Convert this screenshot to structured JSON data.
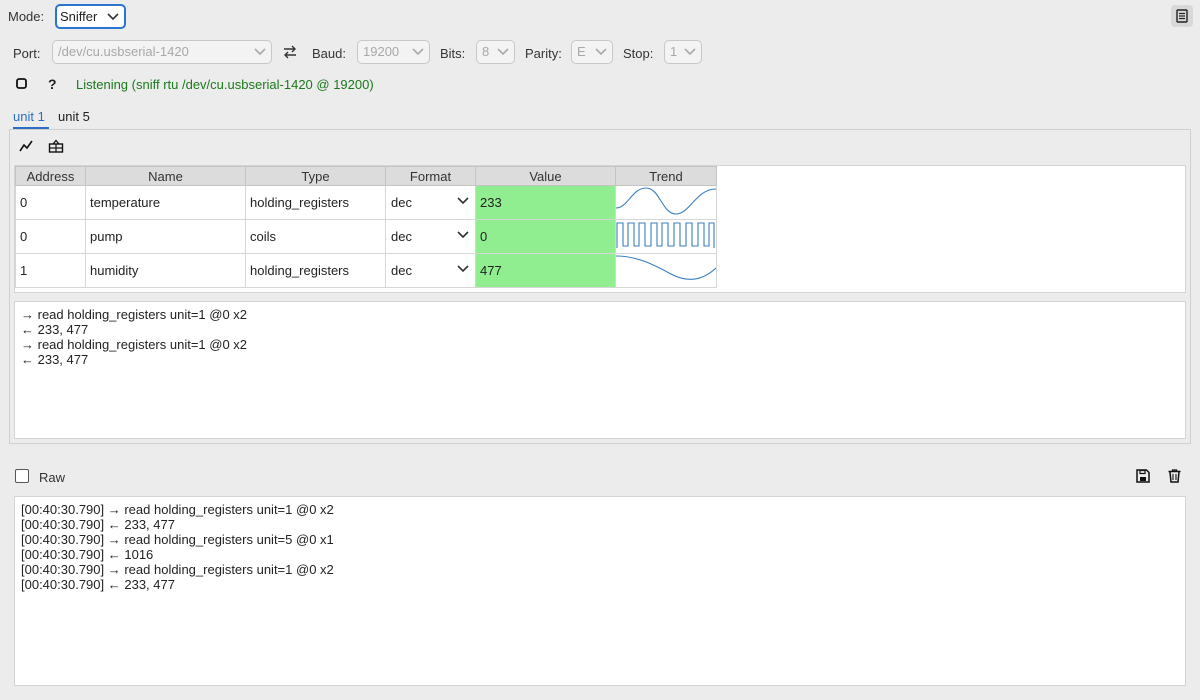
{
  "toolbar": {
    "mode_label": "Mode:",
    "mode_value": "Sniffer",
    "port_label": "Port:",
    "port_value": "/dev/cu.usbserial-1420",
    "baud_label": "Baud:",
    "baud_value": "19200",
    "bits_label": "Bits:",
    "bits_value": "8",
    "parity_label": "Parity:",
    "parity_value": "E",
    "stop_label": "Stop:",
    "stop_value": "1"
  },
  "status": {
    "text": "Listening (sniff rtu /dev/cu.usbserial-1420 @ 19200)",
    "help_label": "?"
  },
  "tabs": [
    {
      "label": "unit 1",
      "active": true
    },
    {
      "label": "unit 5",
      "active": false
    }
  ],
  "table": {
    "headers": [
      "Address",
      "Name",
      "Type",
      "Format",
      "Value",
      "Trend"
    ],
    "rows": [
      {
        "address": "0",
        "name": "temperature",
        "type": "holding_registers",
        "format": "dec",
        "value": "233"
      },
      {
        "address": "0",
        "name": "pump",
        "type": "coils",
        "format": "dec",
        "value": "0"
      },
      {
        "address": "1",
        "name": "humidity",
        "type": "holding_registers",
        "format": "dec",
        "value": "477"
      }
    ]
  },
  "unit_log": [
    "→ read holding_registers unit=1 @0 x2",
    "← 233, 477",
    "→ read holding_registers unit=1 @0 x2",
    "← 233, 477"
  ],
  "raw": {
    "label": "Raw",
    "checked": false
  },
  "raw_log": [
    "[00:40:30.790] → read holding_registers unit=1 @0 x2",
    "[00:40:30.790] ← 233, 477",
    "[00:40:30.790] → read holding_registers unit=5 @0 x1",
    "[00:40:30.790] ← 1016",
    "[00:40:30.790] → read holding_registers unit=1 @0 x2",
    "[00:40:30.790] ← 233, 477"
  ],
  "colors": {
    "accent": "#2a6fc4",
    "status_green": "#1a7a1a",
    "value_bg": "#90ee90",
    "trend_line": "#3a7fc0"
  },
  "icons": {
    "panel_toggle": "sidebar-icon",
    "swap": "swap-arrows-icon",
    "stop": "stop-square-icon",
    "chart": "line-chart-icon",
    "write": "write-register-icon",
    "save": "floppy-disk-icon",
    "trash": "trash-icon"
  }
}
